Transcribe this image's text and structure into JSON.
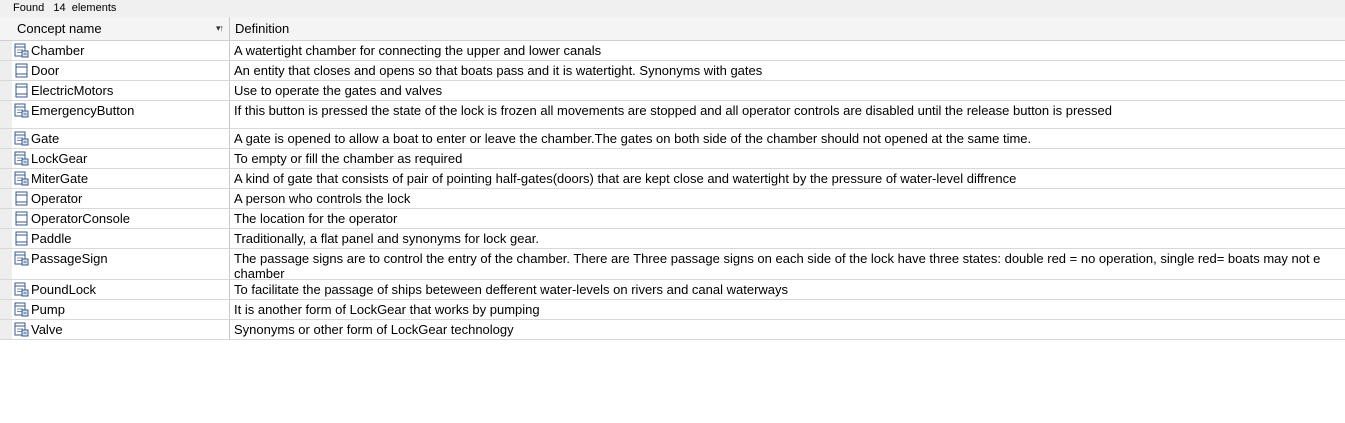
{
  "status": {
    "label": "Found",
    "count": "14",
    "suffix": "elements"
  },
  "columns": {
    "name": "Concept name",
    "definition": "Definition"
  },
  "rows": [
    {
      "name": "Chamber",
      "icon": "class-icon",
      "definition": "A watertight chamber for connecting the upper and lower canals"
    },
    {
      "name": "Door",
      "icon": "entity-icon",
      "definition": "An entity that closes and opens so that boats pass and it is watertight. Synonyms with gates"
    },
    {
      "name": "ElectricMotors",
      "icon": "entity-icon",
      "definition": "Use to operate the gates and valves"
    },
    {
      "name": "EmergencyButton",
      "icon": "class-icon",
      "definition": "If this button is pressed the state of the lock is frozen all movements are stopped and all operator controls are disabled until the release button is pressed"
    },
    {
      "name": "Gate",
      "icon": "class-icon",
      "definition": "A gate is opened to allow a boat to enter or leave the chamber.The gates on both side of the chamber should not opened at the same time."
    },
    {
      "name": "LockGear",
      "icon": "class-icon",
      "definition": "To empty or fill the chamber as required"
    },
    {
      "name": "MiterGate",
      "icon": "class-icon",
      "definition": "A kind of gate that consists of pair of pointing half-gates(doors) that are kept close and watertight by the pressure of water-level diffrence"
    },
    {
      "name": "Operator",
      "icon": "entity-icon",
      "definition": "A person who controls the lock"
    },
    {
      "name": "OperatorConsole",
      "icon": "entity-icon",
      "definition": "The location for the operator"
    },
    {
      "name": "Paddle",
      "icon": "entity-icon",
      "definition": "Traditionally, a flat panel and synonyms for lock gear."
    },
    {
      "name": "PassageSign",
      "icon": "class-icon",
      "definition": "The passage signs are to control the entry of the chamber. There are Three passage signs on each side of the lock have three states: double red = no operation, single red= boats may not e chamber"
    },
    {
      "name": "PoundLock",
      "icon": "class-icon",
      "definition": "To facilitate the passage of ships beteween defferent water-levels on rivers and canal waterways"
    },
    {
      "name": "Pump",
      "icon": "class-icon",
      "definition": "It is another form of LockGear that works by pumping"
    },
    {
      "name": "Valve",
      "icon": "class-icon",
      "definition": "Synonyms or other form of LockGear technology"
    }
  ]
}
